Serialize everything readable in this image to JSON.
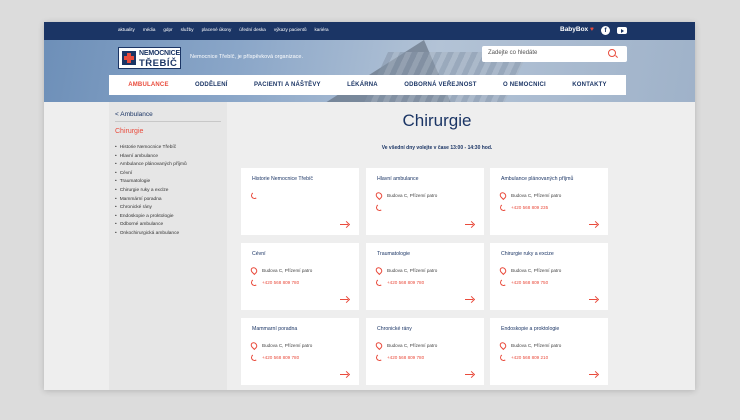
{
  "topbar": {
    "links": [
      "aktuality",
      "média",
      "gdpr",
      "služby",
      "placené úkony",
      "úřední deska",
      "výkazy pacientů",
      "kariéra"
    ],
    "babybox": "BabyBox",
    "facebook_icon": "facebook-icon",
    "youtube_icon": "youtube-icon"
  },
  "logo": {
    "line1": "NEMOCNICE",
    "line2": "TŘEBÍČ"
  },
  "tagline": "Nemocnice Třebíč, je příspěvková organizace.",
  "search": {
    "placeholder": "Zadejte co hledáte"
  },
  "nav": {
    "items": [
      "AMBULANCE",
      "ODDĚLENÍ",
      "PACIENTI A NÁŠTĚVY",
      "LÉKÁRNA",
      "ODBORNÁ VEŘEJNOST",
      "O NEMOCNICI",
      "KONTAKTY"
    ],
    "active": "AMBULANCE"
  },
  "sidebar": {
    "back": "< Ambulance",
    "title": "Chirurgie",
    "items": [
      "Historie Nemocnice Třebíč",
      "Hlavní ambulance",
      "Ambulance plánovaných příjmů",
      "Cévní",
      "Traumatologie",
      "Chirurgie ruky a exclze",
      "Mammární poradna",
      "Chronické rány",
      "Endoskopie a proktologie",
      "Odborné ambulance",
      "Onkochirurgická ambulance"
    ]
  },
  "main": {
    "title": "Chirurgie",
    "hours": "Ve všední dny volejte v čase 13:00 - 14:30 hod.",
    "cards": [
      {
        "name": "Historie Nemocnice Třebíč",
        "location": "",
        "phone": ""
      },
      {
        "name": "Hlavní ambulance",
        "location": "Budova C, Přízemí patro",
        "phone": ""
      },
      {
        "name": "Ambulance plánovaných příjmů",
        "location": "Budova C, Přízemí patro",
        "phone": "+420 568 809 235"
      },
      {
        "name": "Cévní",
        "location": "Budova C, Přízemí patro",
        "phone": "+420 568 809 780"
      },
      {
        "name": "Traumatologie",
        "location": "Budova C, Přízemí patro",
        "phone": "+420 568 809 780"
      },
      {
        "name": "Chirurgie ruky a excize",
        "location": "Budova C, Přízemí patro",
        "phone": "+420 568 809 750"
      },
      {
        "name": "Mammarní poradna",
        "location": "Budova C, Přízemí patro",
        "phone": "+420 568 809 780"
      },
      {
        "name": "Chronické rány",
        "location": "Budova C, Přízemí patro",
        "phone": "+420 568 809 780"
      },
      {
        "name": "Endoskopie a proktologie",
        "location": "Budova C, Přízemí patro",
        "phone": "+420 568 809 210"
      }
    ]
  },
  "colors": {
    "navy": "#1b3565",
    "accent": "#e94b3c"
  }
}
